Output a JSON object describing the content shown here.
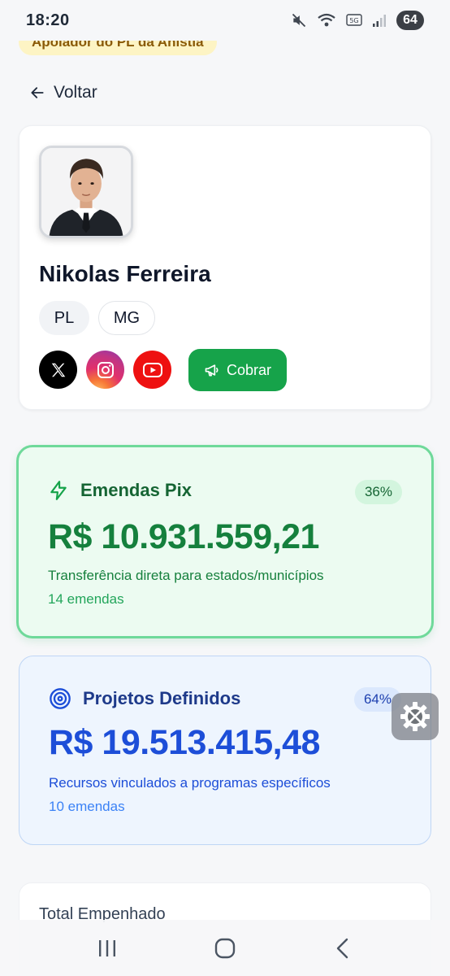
{
  "status_bar": {
    "time": "18:20",
    "battery": "64"
  },
  "supporter_badge": "Apoiador do PL da Anistia",
  "back_label": "Voltar",
  "profile": {
    "name": "Nikolas Ferreira",
    "party": "PL",
    "state": "MG",
    "cobrar_label": "Cobrar"
  },
  "pix": {
    "title": "Emendas Pix",
    "percent": "36%",
    "amount": "R$ 10.931.559,21",
    "description": "Transferência direta para estados/municípios",
    "count": "14 emendas"
  },
  "projetos": {
    "title": "Projetos Definidos",
    "percent": "64%",
    "amount": "R$ 19.513.415,48",
    "description": "Recursos vinculados a programas específicos",
    "count": "10 emendas"
  },
  "total": {
    "label": "Total Empenhado"
  },
  "colors": {
    "green_accent": "#16a34a",
    "blue_accent": "#1d4ed8",
    "badge_bg": "#fdf4c4"
  },
  "icons": {
    "back": "arrow-left-icon",
    "x": "x-logo-icon",
    "instagram": "instagram-icon",
    "youtube": "youtube-icon",
    "cobrar": "megaphone-icon",
    "pix": "lightning-icon",
    "projetos": "target-icon",
    "floating": "tools-gear-icon"
  }
}
